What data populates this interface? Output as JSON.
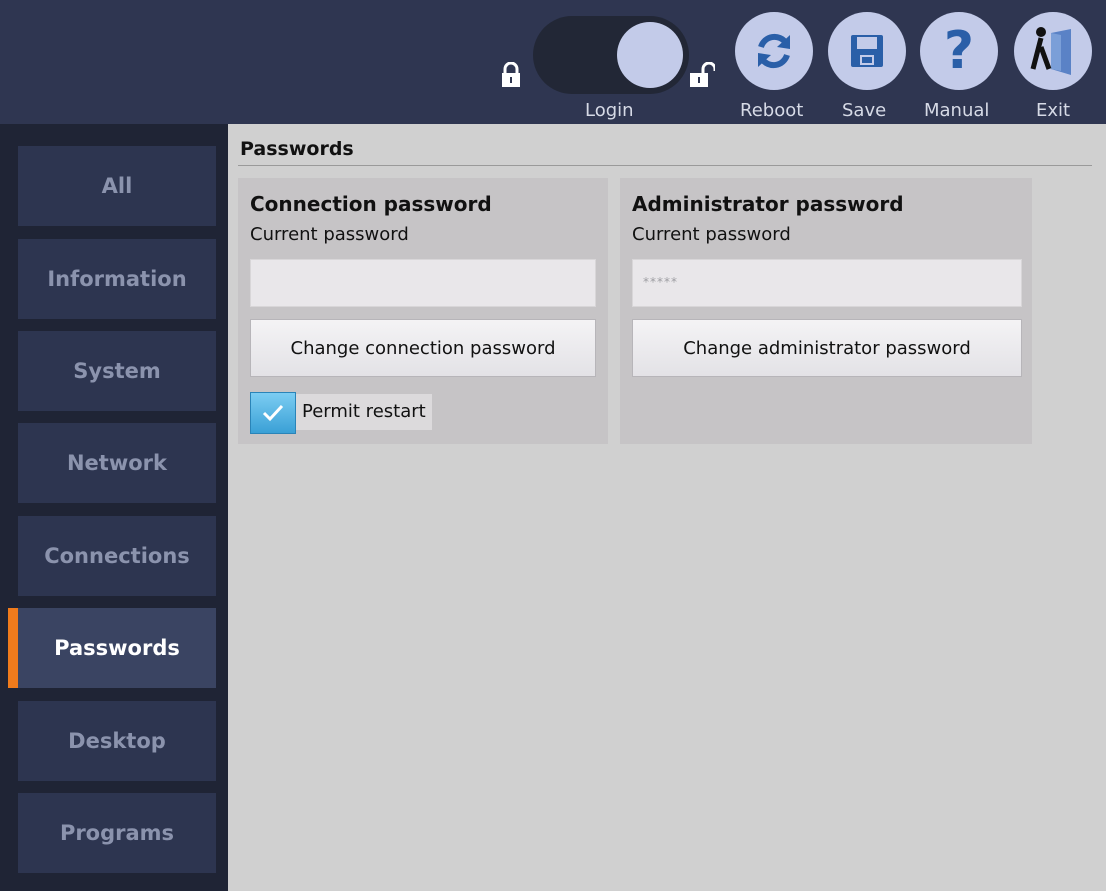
{
  "toolbar": {
    "login_label": "Login",
    "reboot_label": "Reboot",
    "save_label": "Save",
    "manual_label": "Manual",
    "exit_label": "Exit"
  },
  "sidebar": {
    "items": [
      {
        "label": "All"
      },
      {
        "label": "Information"
      },
      {
        "label": "System"
      },
      {
        "label": "Network"
      },
      {
        "label": "Connections"
      },
      {
        "label": "Passwords"
      },
      {
        "label": "Desktop"
      },
      {
        "label": "Programs"
      }
    ],
    "active_item": "Passwords"
  },
  "main": {
    "section_title": "Passwords",
    "connection": {
      "title": "Connection password",
      "subtitle": "Current password",
      "value": "",
      "button_label": "Change connection password",
      "checkbox_label": "Permit restart",
      "checkbox_checked": true
    },
    "administrator": {
      "title": "Administrator password",
      "subtitle": "Current password",
      "value": "*****",
      "button_label": "Change administrator password"
    }
  },
  "colors": {
    "topbar": "#2f3651",
    "sidebar_bg": "#1f2435",
    "accent": "#f07b1c",
    "button_circle": "#c3cbe9",
    "icon_blue": "#2a5fa8"
  }
}
